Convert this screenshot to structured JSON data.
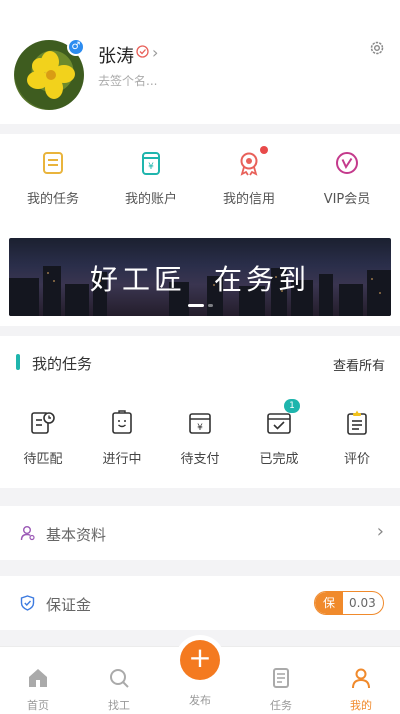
{
  "profile": {
    "name": "张涛",
    "signature": "去签个名...",
    "gender_icon": "male-icon",
    "gender_symbol": "♂",
    "chevron": "›"
  },
  "shortcuts": [
    {
      "label": "我的任务",
      "icon": "task-list-icon",
      "color": "#e9b43c"
    },
    {
      "label": "我的账户",
      "icon": "wallet-icon",
      "color": "#1fb5ad"
    },
    {
      "label": "我的信用",
      "icon": "credit-medal-icon",
      "color": "#e8615a"
    },
    {
      "label": "VIP会员",
      "icon": "vip-icon",
      "color": "#c43a8c"
    }
  ],
  "banner": {
    "text_left": "好工匠",
    "text_right": "在务到"
  },
  "my_tasks": {
    "title": "我的任务",
    "view_all": "查看所有",
    "items": [
      {
        "label": "待匹配",
        "icon": "pending-match-icon"
      },
      {
        "label": "进行中",
        "icon": "in-progress-icon"
      },
      {
        "label": "待支付",
        "icon": "pending-payment-icon"
      },
      {
        "label": "已完成",
        "icon": "completed-icon",
        "badge": "1"
      },
      {
        "label": "评价",
        "icon": "review-icon"
      }
    ]
  },
  "basic_info": {
    "label": "基本资料",
    "chevron": "›"
  },
  "deposit": {
    "label": "保证金",
    "tag": "保",
    "amount": "0.03"
  },
  "tabbar": {
    "home": "首页",
    "find_worker": "找工",
    "publish": "发布",
    "publish_symbol": "+",
    "tasks": "任务",
    "mine": "我的"
  },
  "colors": {
    "accent": "#f08a2c",
    "teal": "#1fb5ad"
  }
}
